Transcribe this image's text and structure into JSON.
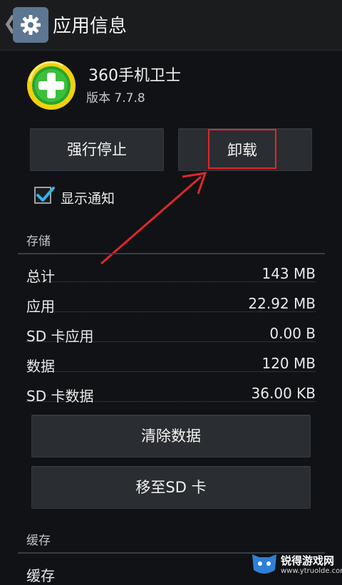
{
  "header": {
    "title": "应用信息",
    "back_icon": "chevron-left-icon",
    "settings_icon": "gear-icon"
  },
  "app": {
    "name": "360手机卫士",
    "version": "版本 7.7.8",
    "icon": "360-security-logo"
  },
  "actions": {
    "force_stop": "强行停止",
    "uninstall": "卸载"
  },
  "notification": {
    "label": "显示通知",
    "checked": true
  },
  "storage": {
    "section_title": "存储",
    "rows": [
      {
        "label": "总计",
        "value": "143 MB"
      },
      {
        "label": "应用",
        "value": "22.92 MB"
      },
      {
        "label": "SD 卡应用",
        "value": "0.00 B"
      },
      {
        "label": "数据",
        "value": "120 MB"
      },
      {
        "label": "SD 卡数据",
        "value": "36.00 KB"
      }
    ],
    "clear_data": "清除数据",
    "move_to_sd": "移至SD 卡"
  },
  "cache": {
    "section_title": "缓存",
    "row_label": "缓存"
  },
  "watermark": {
    "text": "锐得游戏网",
    "url": "www.ytruolde.com"
  },
  "colors": {
    "highlight": "#e0262c",
    "checkbox": "#33b5e5",
    "settings_badge": "#5d7692"
  }
}
